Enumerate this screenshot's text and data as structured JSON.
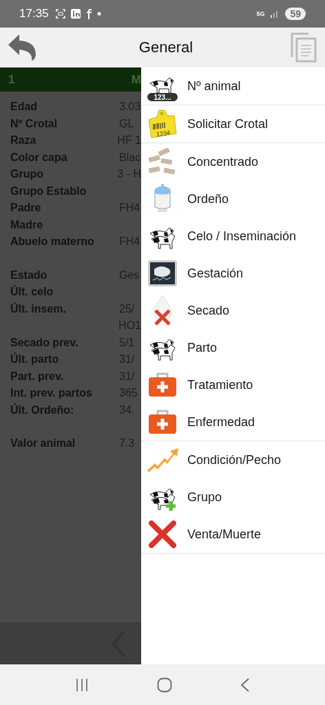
{
  "status_bar": {
    "time": "17:35",
    "network": "5G",
    "battery": "59"
  },
  "app_bar": {
    "title": "General"
  },
  "details": {
    "header": [
      "1",
      "M"
    ],
    "sections": [
      [
        {
          "label": "Edad",
          "value": "3.03"
        },
        {
          "label": "Nº Crotal",
          "value": "GL"
        },
        {
          "label": "Raza",
          "value": "HF 1"
        },
        {
          "label": "Color capa",
          "value": "Blac"
        },
        {
          "label": "Grupo",
          "value": "3 - H"
        },
        {
          "label": "Grupo Establo"
        },
        {
          "label": "Padre",
          "value": "FH4"
        },
        {
          "label": "Madre"
        },
        {
          "label": "Abuelo materno",
          "value": "FH4"
        }
      ],
      [
        {
          "label": "Estado",
          "value": "Ges"
        },
        {
          "label": "Últ. celo"
        },
        {
          "label": "Últ. insem.",
          "value": "25/"
        },
        {
          "value": "HO1"
        },
        {
          "label": "Secado prev.",
          "value": "5/1"
        },
        {
          "label": "Últ. parto",
          "value": "31/"
        },
        {
          "label": "Part. prev.",
          "value": "31/"
        },
        {
          "label": "Int. prev. partos",
          "value": "365"
        },
        {
          "label": "Últ. Ordeño:",
          "value": "34."
        }
      ],
      [
        {
          "label": "Valor animal",
          "value": "7.3"
        }
      ]
    ]
  },
  "drawer": {
    "groups": [
      [
        {
          "label": "Nº animal",
          "kind": "number",
          "icon_text": "123..."
        }
      ],
      [
        {
          "label": "Solicitar Crotal",
          "kind": "tag",
          "icon_text": "1234"
        }
      ],
      [
        {
          "label": "Concentrado",
          "kind": "feed"
        },
        {
          "label": "Ordeño",
          "kind": "milk"
        },
        {
          "label": "Celo / Inseminación",
          "kind": "herd"
        },
        {
          "label": "Gestación",
          "kind": "scan"
        },
        {
          "label": "Secado",
          "kind": "dry"
        },
        {
          "label": "Parto",
          "kind": "herd"
        },
        {
          "label": "Tratamiento",
          "kind": "medical"
        },
        {
          "label": "Enfermedad",
          "kind": "medical"
        }
      ],
      [
        {
          "label": "Condición/Pecho",
          "kind": "trend"
        },
        {
          "label": "Grupo",
          "kind": "group"
        },
        {
          "label": "Venta/Muerte",
          "kind": "exit"
        }
      ]
    ]
  }
}
